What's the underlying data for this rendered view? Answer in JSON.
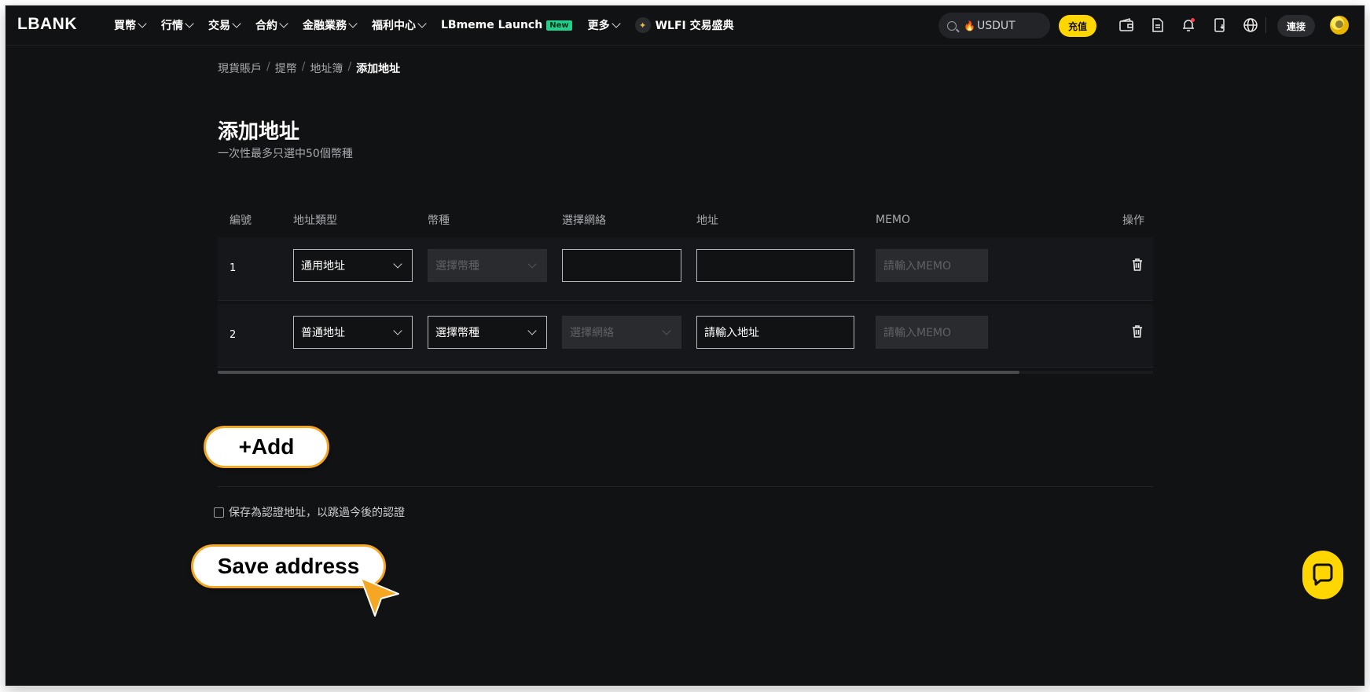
{
  "header": {
    "logo": "LBANK",
    "nav": [
      {
        "label": "買幣",
        "has_dropdown": true
      },
      {
        "label": "行情",
        "has_dropdown": true
      },
      {
        "label": "交易",
        "has_dropdown": true
      },
      {
        "label": "合約",
        "has_dropdown": true
      },
      {
        "label": "金融業務",
        "has_dropdown": true
      },
      {
        "label": "福利中心",
        "has_dropdown": true
      },
      {
        "label": "LBmeme Launch",
        "badge": "New"
      },
      {
        "label": "更多",
        "has_dropdown": true
      },
      {
        "label": "WLFI 交易盛典"
      }
    ],
    "search_text": "USDUT",
    "deposit_label": "充值",
    "connect_label": "連接",
    "icons": [
      "wallet-icon",
      "document-icon",
      "bell-icon",
      "download-app-icon",
      "globe-icon"
    ]
  },
  "breadcrumb": {
    "items": [
      "現貨賬戶",
      "提幣",
      "地址簿",
      "添加地址"
    ],
    "separator": "/"
  },
  "page": {
    "title": "添加地址",
    "subtitle": "一次性最多只選中50個幣種"
  },
  "table": {
    "headers": [
      "編號",
      "地址類型",
      "幣種",
      "選擇網絡",
      "地址",
      "MEMO",
      "操作"
    ],
    "rows": [
      {
        "number": "1",
        "address_type": "通用地址",
        "currency": "選擇幣種",
        "network": "",
        "address": "",
        "memo": "請輸入MEMO"
      },
      {
        "number": "2",
        "address_type": "普通地址",
        "currency": "選擇幣種",
        "network": "選擇網絡",
        "address": "請輸入地址",
        "memo": "請輸入MEMO"
      }
    ]
  },
  "add_button": "+Add",
  "save_as_verified_label": "保存為認證地址，以跳過今後的認證",
  "save_button": "Save address",
  "colors": {
    "background": "#111213",
    "accent": "#ffd600",
    "highlight_border": "#f5a623"
  }
}
